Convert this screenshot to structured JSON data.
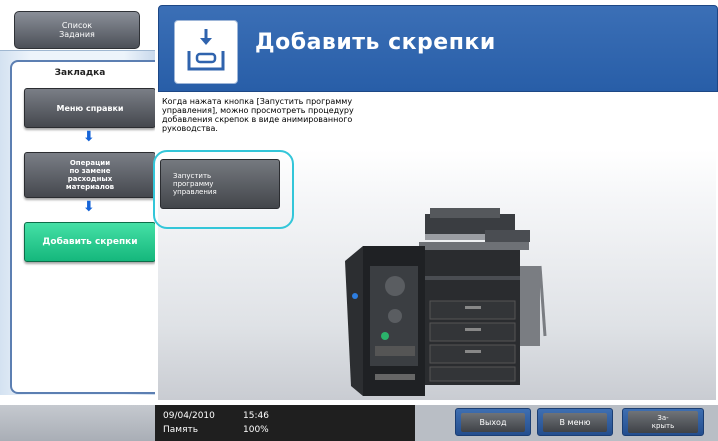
{
  "sidebar": {
    "job_list_label": "Список\nЗадания",
    "bookmark_title": "Закладка",
    "items": [
      {
        "label": "Меню справки"
      },
      {
        "label": "Операции\nпо замене\nрасходных\nматериалов"
      },
      {
        "label": "Добавить скрепки"
      }
    ]
  },
  "header": {
    "title": "Добавить скрепки",
    "icon": "staple-cartridge-icon"
  },
  "main": {
    "description": "Когда нажата кнопка [Запустить программу\nуправления], можно просмотреть процедуру\nдобавления скрепок в виде анимированного\nруководства.",
    "start_button_label": "Запустить\nпрограмму\nуправления"
  },
  "footer": {
    "date": "09/04/2010",
    "time": "15:46",
    "memory_label": "Память",
    "memory_value": "100%",
    "buttons": [
      {
        "label": "Выход"
      },
      {
        "label": "В меню"
      },
      {
        "label": "За-\nкрыть"
      }
    ]
  },
  "colors": {
    "header_blue": "#2f63ad",
    "active_green": "#1fc688",
    "arrow_blue": "#1664d8",
    "highlight_ring": "#33c6d9"
  }
}
